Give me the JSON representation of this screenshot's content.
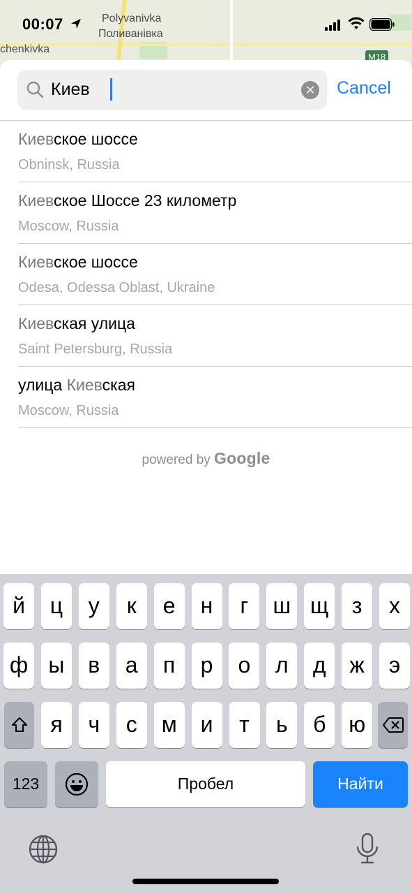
{
  "status_bar": {
    "time": "00:07"
  },
  "map": {
    "label_1": "Polyvanivka",
    "label_2": "Поливанівка",
    "label_3": "chenkivka",
    "road_badge": "M18"
  },
  "search": {
    "query": "Киев",
    "cancel_label": "Cancel"
  },
  "results": [
    {
      "pre": "",
      "highlight": "Киев",
      "post": "ское шоссе",
      "subtitle": "Obninsk, Russia"
    },
    {
      "pre": "",
      "highlight": "Киев",
      "post": "ское Шоссе 23 километр",
      "subtitle": "Moscow, Russia"
    },
    {
      "pre": "",
      "highlight": "Киев",
      "post": "ское шоссе",
      "subtitle": "Odesa, Odessa Oblast, Ukraine"
    },
    {
      "pre": "",
      "highlight": "Киев",
      "post": "ская улица",
      "subtitle": "Saint Petersburg, Russia"
    },
    {
      "pre": "улица ",
      "highlight": "Киев",
      "post": "ская",
      "subtitle": "Moscow, Russia"
    }
  ],
  "attribution": {
    "powered_by": "powered by",
    "brand": "Google"
  },
  "keyboard": {
    "row1": [
      "й",
      "ц",
      "у",
      "к",
      "е",
      "н",
      "г",
      "ш",
      "щ",
      "з",
      "х"
    ],
    "row2": [
      "ф",
      "ы",
      "в",
      "а",
      "п",
      "р",
      "о",
      "л",
      "д",
      "ж",
      "э"
    ],
    "row3": [
      "я",
      "ч",
      "с",
      "м",
      "и",
      "т",
      "ь",
      "б",
      "ю"
    ],
    "numbers_label": "123",
    "space_label": "Пробел",
    "go_label": "Найти",
    "icons": [
      "shift-icon",
      "backspace-icon",
      "emoji-icon",
      "globe-icon",
      "microphone-icon"
    ]
  },
  "colors": {
    "accent": "#1a84ff",
    "keyboard_bg": "#d1d3d9"
  }
}
